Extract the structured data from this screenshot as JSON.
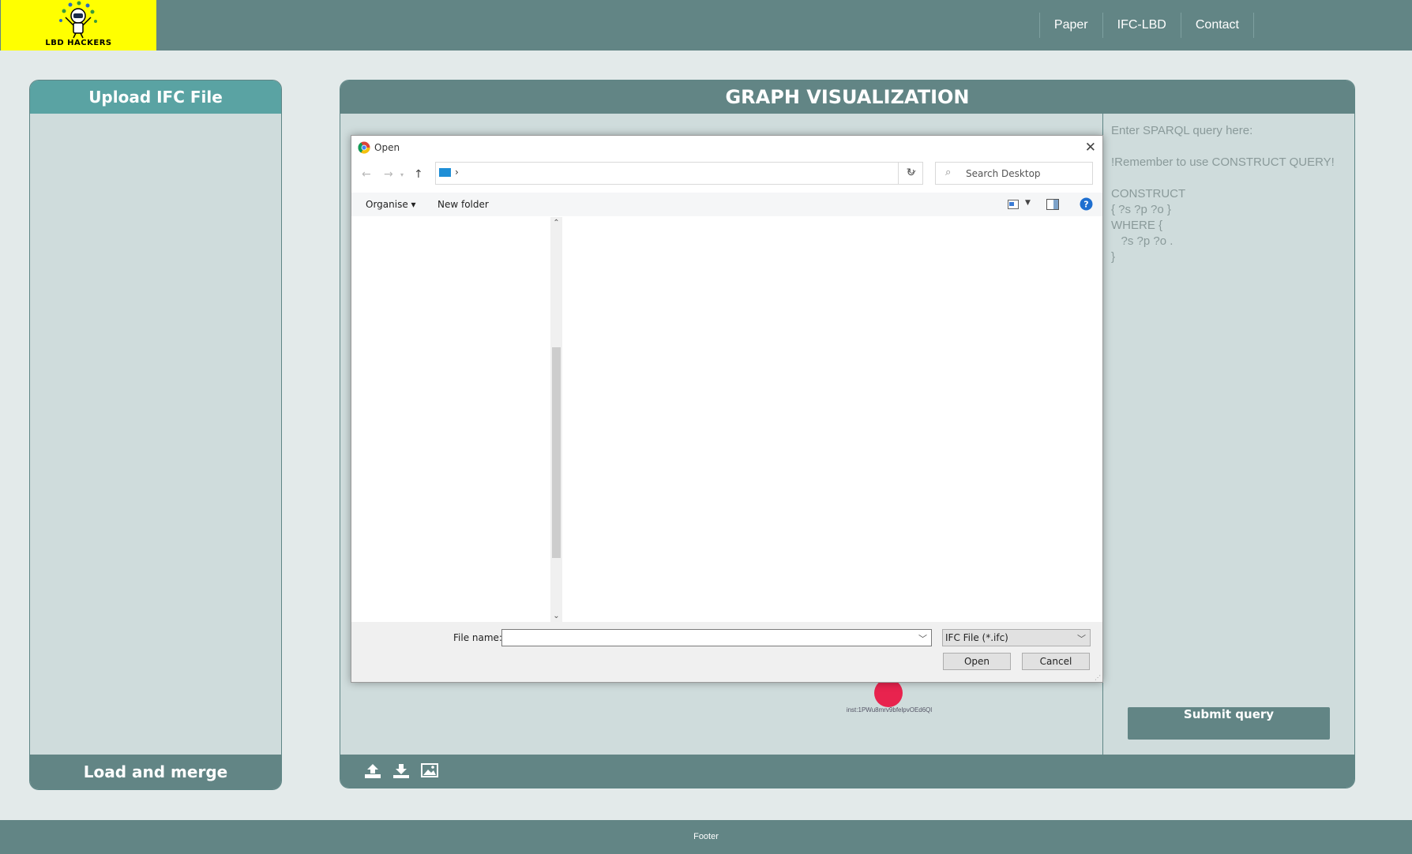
{
  "logo": {
    "text": "LBD HACKERS"
  },
  "nav": {
    "items": [
      "Paper",
      "IFC-LBD",
      "Contact"
    ]
  },
  "upload_panel": {
    "title": "Upload IFC File",
    "footer_button": "Load and merge"
  },
  "graph_panel": {
    "title": "GRAPH VISUALIZATION",
    "node_label": "inst:1PWu8mrv9bfelpvOEd6Ql",
    "toolbar_icons": [
      "upload-icon",
      "download-icon",
      "image-icon"
    ]
  },
  "query": {
    "placeholder": "Enter SPARQL query here:\n\n!Remember to use CONSTRUCT QUERY!\n\nCONSTRUCT\n{ ?s ?p ?o }\nWHERE {\n   ?s ?p ?o .\n}",
    "submit_label": "Submit query"
  },
  "dialog": {
    "title": "Open",
    "search_placeholder": "Search Desktop",
    "organise": "Organise",
    "new_folder": "New folder",
    "file_name_label": "File name:",
    "file_name_value": "",
    "file_type": "IFC File (*.ifc)",
    "open_label": "Open",
    "cancel_label": "Cancel",
    "address_separator": "›"
  },
  "footer": {
    "text": "Footer"
  },
  "colors": {
    "header_bar": "#628585",
    "upload_header": "#5aa3a3",
    "panel_bg": "#cfdcdc",
    "page_bg": "#e3eaea",
    "logo_bg": "#ffff00",
    "node": "#e8234e"
  }
}
